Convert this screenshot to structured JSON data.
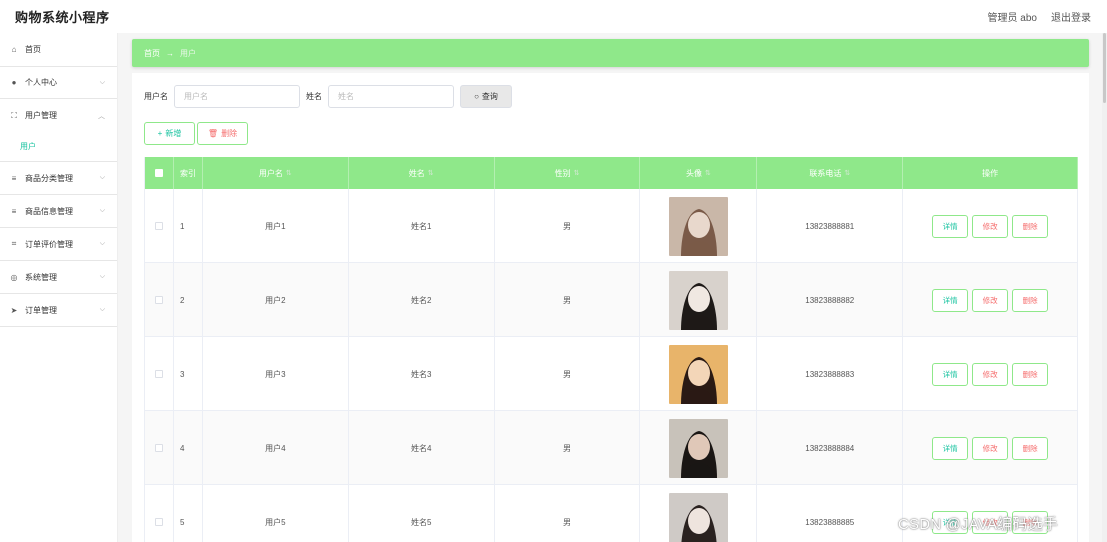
{
  "app": {
    "title": "购物系统小程序"
  },
  "header": {
    "admin_label": "管理员 abo",
    "logout_label": "退出登录"
  },
  "sidebar": {
    "items": [
      {
        "label": "首页",
        "icon": "home-icon",
        "glyph": "⌂"
      },
      {
        "label": "个人中心",
        "icon": "user-icon",
        "glyph": "●"
      },
      {
        "label": "用户管理",
        "icon": "frame-icon",
        "glyph": "⛶"
      },
      {
        "label": "商品分类管理",
        "icon": "list-icon",
        "glyph": "≡"
      },
      {
        "label": "商品信息管理",
        "icon": "list-icon",
        "glyph": "≡"
      },
      {
        "label": "订单评价管理",
        "icon": "crop-icon",
        "glyph": "⌗"
      },
      {
        "label": "系统管理",
        "icon": "globe-icon",
        "glyph": "◎"
      },
      {
        "label": "订单管理",
        "icon": "send-icon",
        "glyph": "➤"
      }
    ],
    "sub_item": "用户"
  },
  "breadcrumb": {
    "home": "首页",
    "separator": "→",
    "current": "用户"
  },
  "search": {
    "username_label": "用户名",
    "username_placeholder": "用户名",
    "name_label": "姓名",
    "name_placeholder": "姓名",
    "query_label": "查询"
  },
  "actions": {
    "add_label": "新增",
    "delete_label": "删除"
  },
  "table": {
    "columns": {
      "index": "索引",
      "username": "用户名",
      "name": "姓名",
      "gender": "性别",
      "avatar": "头像",
      "phone": "联系电话",
      "ops": "操作"
    },
    "op_labels": {
      "detail": "详情",
      "edit": "修改",
      "remove": "删除"
    },
    "rows": [
      {
        "index": "1",
        "username": "用户1",
        "name": "姓名1",
        "gender": "男",
        "phone": "13823888881"
      },
      {
        "index": "2",
        "username": "用户2",
        "name": "姓名2",
        "gender": "男",
        "phone": "13823888882"
      },
      {
        "index": "3",
        "username": "用户3",
        "name": "姓名3",
        "gender": "男",
        "phone": "13823888883"
      },
      {
        "index": "4",
        "username": "用户4",
        "name": "姓名4",
        "gender": "男",
        "phone": "13823888884"
      },
      {
        "index": "5",
        "username": "用户5",
        "name": "姓名5",
        "gender": "男",
        "phone": "13823888885"
      }
    ]
  },
  "watermark": "CSDN @JAVA编码选手",
  "colors": {
    "accent_green": "#8fe88a",
    "link_teal": "#19c3a0",
    "danger": "#f56c6c"
  }
}
